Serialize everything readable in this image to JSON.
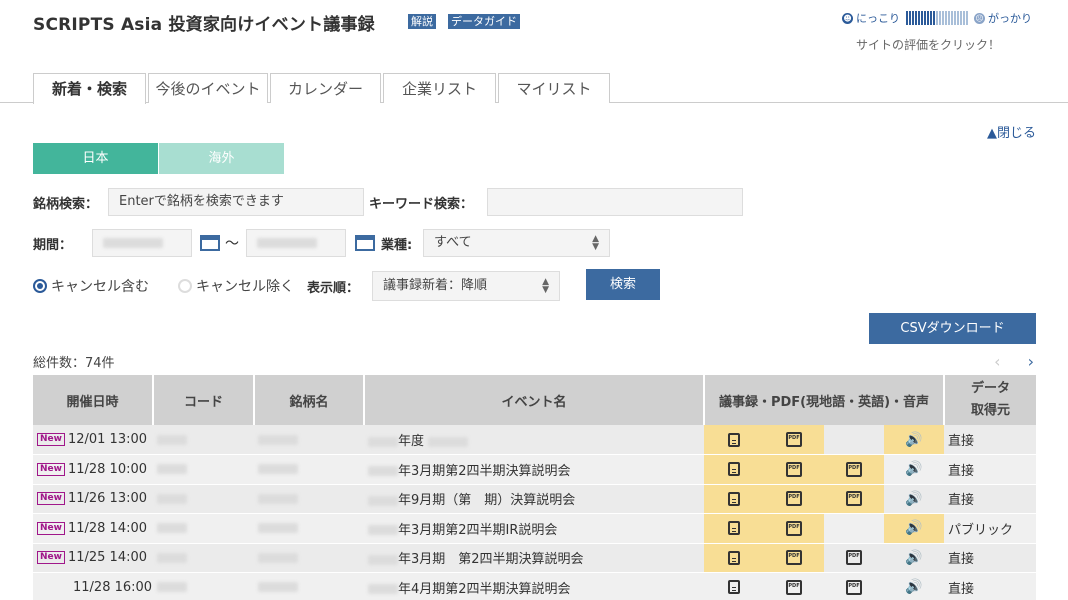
{
  "header": {
    "title": "SCRIPTS Asia 投資家向けイベント議事録",
    "tag1": "解説",
    "tag2": "データガイド",
    "rating_good": "にっこり",
    "rating_bad": "がっかり",
    "rating_sub": "サイトの評価をクリック！"
  },
  "tabs": [
    "新着・検索",
    "今後のイベント",
    "カレンダー",
    "企業リスト",
    "マイリスト"
  ],
  "close_label": "▲閉じる",
  "regions": {
    "japan": "日本",
    "overseas": "海外"
  },
  "search": {
    "stock_label": "銘柄検索：",
    "stock_placeholder": "Enterで銘柄を検索できます",
    "keyword_label": "キーワード検索：",
    "period_label": "期間：",
    "tilde": "〜",
    "industry_label": "業種:",
    "industry_value": "すべて",
    "cancel_include": "キャンセル含む",
    "cancel_exclude": "キャンセル除く",
    "order_label": "表示順：",
    "order_value": "議事録新着：降順",
    "search_button": "検索"
  },
  "csv_button": "CSVダウンロード",
  "total_label": "総件数：74件",
  "table": {
    "headers": [
      "開催日時",
      "コード",
      "銘柄名",
      "イベント名",
      "議事録・PDF(現地語・英語)・音声",
      "データ取得元"
    ],
    "header_source_line1": "データ",
    "header_source_line2": "取得元",
    "new_badge": "New",
    "rows": [
      {
        "date": "12/01 13:00",
        "is_new": true,
        "event": "年度",
        "source": "直接"
      },
      {
        "date": "11/28 10:00",
        "is_new": true,
        "event": "年3月期第2四半期決算説明会",
        "source": "直接"
      },
      {
        "date": "11/26 13:00",
        "is_new": true,
        "event": "年9月期（第　期）決算説明会",
        "source": "直接"
      },
      {
        "date": "11/28 14:00",
        "is_new": true,
        "event": "年3月期第2四半期IR説明会",
        "source": "パブリック"
      },
      {
        "date": "11/25 14:00",
        "is_new": true,
        "event": "年3月期　第2四半期決算説明会",
        "source": "直接"
      },
      {
        "date": "11/28 16:00",
        "is_new": false,
        "event": "年4月期第2四半期決算説明会",
        "source": "直接"
      }
    ]
  }
}
